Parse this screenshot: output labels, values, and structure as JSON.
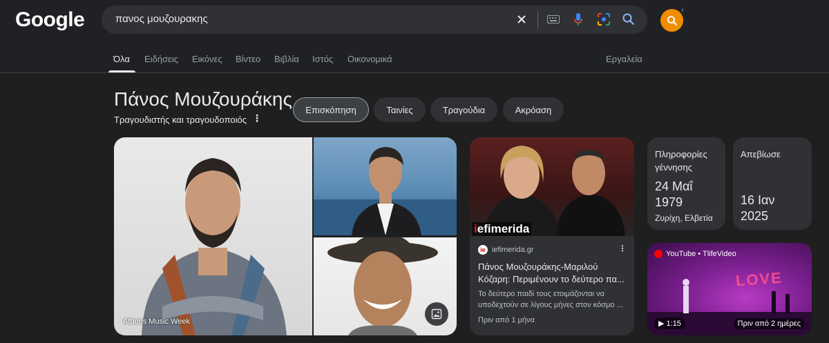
{
  "header": {
    "logo": "Google",
    "search_query": "πανος μουζουρακης"
  },
  "tabs": [
    {
      "label": "Όλα",
      "active": true
    },
    {
      "label": "Ειδήσεις"
    },
    {
      "label": "Εικόνες"
    },
    {
      "label": "Βίντεο"
    },
    {
      "label": "Βιβλία"
    },
    {
      "label": "Ιστός"
    },
    {
      "label": "Οικονομικά"
    }
  ],
  "tools_label": "Εργαλεία",
  "knowledge_panel": {
    "title": "Πάνος Μουζουράκης",
    "subtitle": "Τραγουδιστής και τραγουδοποιός",
    "chips": [
      "Επισκόπηση",
      "Ταινίες",
      "Τραγούδια",
      "Ακρόαση"
    ]
  },
  "images": {
    "main_caption": "Athens Music Week"
  },
  "news_card": {
    "brand_prefix": "i",
    "brand_rest": "efimerida",
    "source": "iefimerida.gr",
    "title": "Πάνος Μουζουράκης-Μαριλού Κόζαρη: Περιμένουν το δεύτερο πα...",
    "snippet": "Το δεύτερο παιδί τους ετοιμάζονται να υποδεχτούν σε λίγους μήνες στον κόσμο ...",
    "time": "Πριν από 1 μήνα"
  },
  "birth_card": {
    "label": "Πληροφορίες γέννησης",
    "date_line1": "24 Μαΐ",
    "date_line2": "1979",
    "place": "Ζυρίχη, Ελβετία"
  },
  "death_card": {
    "label": "Απεβίωσε",
    "date_line1": "16 Ιαν",
    "date_line2": "2025"
  },
  "video_card": {
    "source": "YouTube • TlifeVideo",
    "overlay_text": "LOVE",
    "duration": "1:15",
    "time": "Πριν από 2 ημέρες"
  },
  "colors": {
    "background": "#1f1f1f",
    "surface": "#303134",
    "avatar": "#f08c00"
  }
}
